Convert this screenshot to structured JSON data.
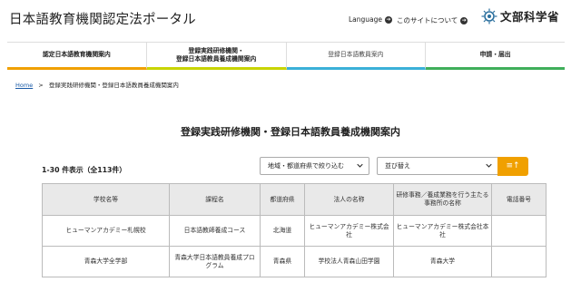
{
  "header": {
    "site_title": "日本語教育機関認定法ポータル",
    "language_link": "Language",
    "about_link": "このサイトについて",
    "logo_text": "文部科学省",
    "arrow_glyph": "➔"
  },
  "nav": {
    "items": [
      {
        "label_line1": "認定日本語教育機関案内",
        "label_line2": ""
      },
      {
        "label_line1": "登録実践研修機関・",
        "label_line2": "登録日本語教員養成機関案内"
      },
      {
        "label_line1": "登録日本語教員案内",
        "label_line2": ""
      },
      {
        "label_line1": "申請・届出",
        "label_line2": ""
      }
    ],
    "colors": [
      "#f0a000",
      "#c8d400",
      "#3ab0d8",
      "#3fae5a"
    ]
  },
  "breadcrumb": {
    "home": "Home",
    "separator": ">",
    "current": "登録実践研修機関・登録日本語教員養成機関案内"
  },
  "page_title": "登録実践研修機関・登録日本語教員養成機関案内",
  "results": {
    "count_text": "1-30 件表示（全113件）"
  },
  "filters": {
    "region_select": "地域・都道府県で絞り込む",
    "sort_select": "並び替え",
    "sort_button_glyph": "≡↑"
  },
  "table": {
    "headers": [
      "学校名等",
      "課程名",
      "都道府県",
      "法人の名称",
      "研修事務／養成業務を行う主たる事務所の名称",
      "電話番号"
    ],
    "rows": [
      [
        "ヒューマンアカデミー札幌校",
        "日本語教師養成コース",
        "北海道",
        "ヒューマンアカデミー株式会社",
        "ヒューマンアカデミー株式会社本社",
        ""
      ],
      [
        "青森大学全学部",
        "青森大学日本語教員養成プログラム",
        "青森県",
        "学校法人青森山田学園",
        "青森大学",
        ""
      ]
    ]
  }
}
